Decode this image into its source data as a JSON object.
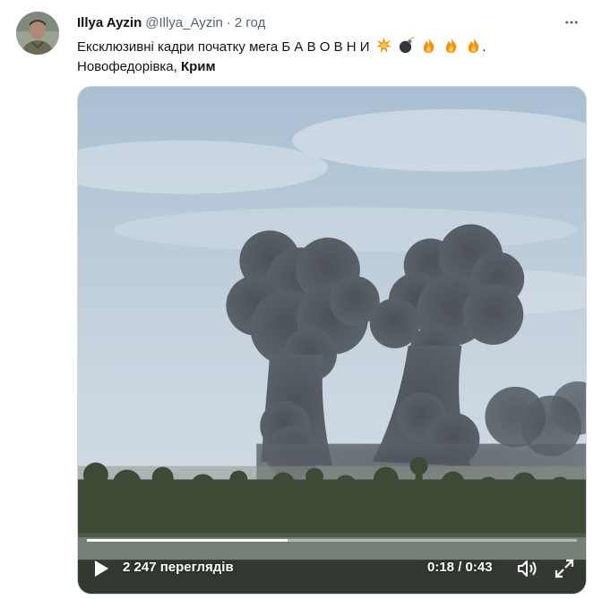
{
  "tweet": {
    "author_name": "Illya Ayzin",
    "author_handle": "@Illya_Ayzin",
    "separator": "·",
    "time": "2 год",
    "text_line1": "Ексклюзивні кадри початку мега Б А В О В Н И",
    "text_line1_end": ".",
    "text_line2_a": "Новофедорівка, ",
    "text_line2_b": "Крим",
    "emojis": [
      "collision-icon",
      "bomb-icon",
      "fire-icon",
      "fire-icon",
      "fire-icon"
    ]
  },
  "video": {
    "views": "2 247 переглядів",
    "timecode": "0:18 / 0:43",
    "progress_fraction": 0.41
  },
  "colors": {
    "text": "#0f1419",
    "secondary": "#536471",
    "border": "#cfd9de"
  }
}
